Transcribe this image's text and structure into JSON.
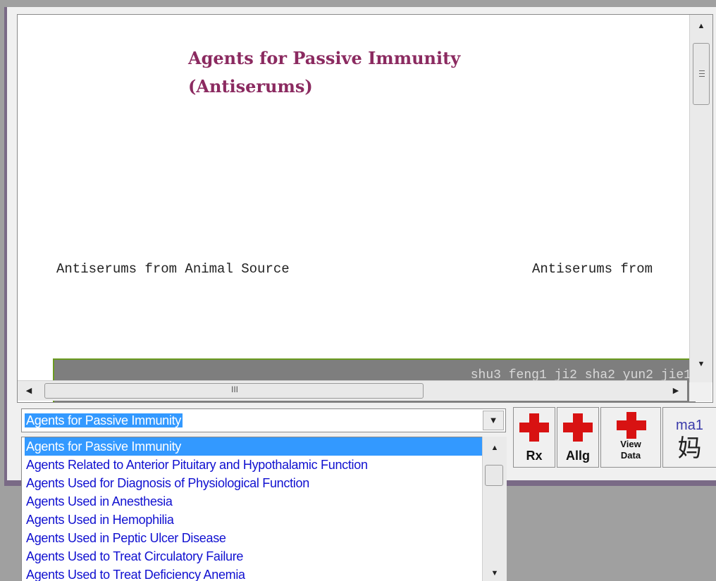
{
  "viewer": {
    "title_line1": "Agents for Passive Immunity",
    "title_line2": "(Antiserums)",
    "node_left": "Antiserums from Animal Source",
    "node_right": "Antiserums from",
    "bar_text": "shu3 feng1 ji2 sha2 yun2 jie1",
    "hscroll_grip": "III"
  },
  "combo": {
    "selected": "Agents for Passive Immunity"
  },
  "list": {
    "items": [
      "Agents for Passive Immunity",
      "Agents Related to Anterior Pituitary and Hypothalamic Function",
      "Agents Used for Diagnosis of Physiological Function",
      "Agents Used in Anesthesia",
      "Agents Used in Hemophilia",
      "Agents Used in Peptic Ulcer Disease",
      "Agents Used to Treat Circulatory Failure",
      "Agents Used to Treat Deficiency Anemia"
    ],
    "selected_index": 0
  },
  "toolbar": {
    "rx_label": "Rx",
    "allg_label": "Allg",
    "view_label_1": "View",
    "view_label_2": "Data",
    "ma_label": "ma1",
    "ma_char": "妈"
  },
  "colors": {
    "title": "#8b2a60",
    "selection": "#3399ff",
    "list_text": "#1010d0",
    "cross": "#d81212",
    "bar": "#7e7e7e",
    "bar_border": "#6a9a20"
  },
  "icons": [
    "scroll-up-arrow",
    "scroll-down-arrow",
    "scroll-left-arrow",
    "scroll-right-arrow",
    "dropdown-arrow",
    "red-cross-icon"
  ]
}
